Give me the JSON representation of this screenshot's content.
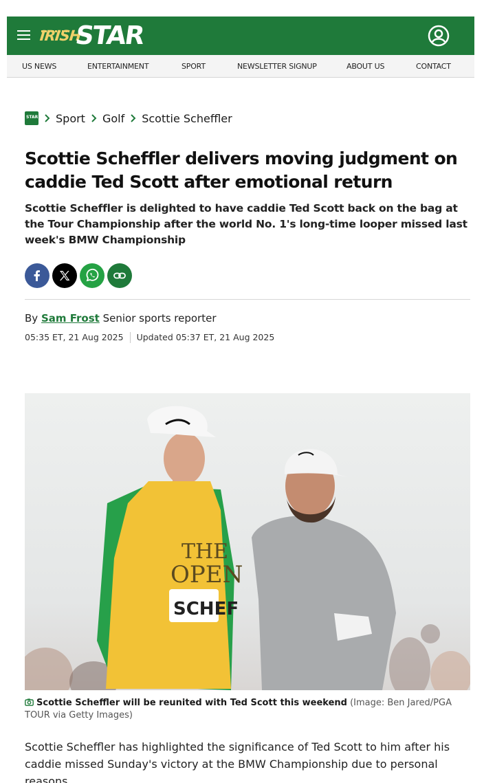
{
  "site": {
    "logo_text_irish": "IRISH",
    "logo_text_star": "STAR",
    "brand_color": "#1f7a3a"
  },
  "nav": {
    "items": [
      {
        "label": "US NEWS"
      },
      {
        "label": "ENTERTAINMENT"
      },
      {
        "label": "SPORT"
      },
      {
        "label": "NEWSLETTER SIGNUP"
      },
      {
        "label": "ABOUT US"
      },
      {
        "label": "CONTACT"
      }
    ]
  },
  "breadcrumb": {
    "logo_text": "STAR",
    "items": [
      {
        "label": "Sport"
      },
      {
        "label": "Golf"
      },
      {
        "label": "Scottie Scheffler"
      }
    ]
  },
  "article": {
    "headline": "Scottie Scheffler delivers moving judgment on caddie Ted Scott after emotional return",
    "standfirst": "Scottie Scheffler is delighted to have caddie Ted Scott back on the bag at the Tour Championship after the world No. 1's long-time looper missed last week's BMW Championship",
    "byline_prefix": "By",
    "author": "Sam Frost",
    "author_role": "Senior sports reporter",
    "published": "05:35 ET, 21 Aug 2025",
    "updated": "Updated 05:37 ET, 21 Aug 2025",
    "image_vest_text_1": "THE",
    "image_vest_text_2": "OPEN",
    "image_vest_name": "SCHEF",
    "caption_main": "Scottie Scheffler will be reunited with Ted Scott this weekend",
    "caption_credit": "(Image: Ben Jared/PGA TOUR via Getty Images)",
    "first_paragraph": "Scottie Scheffler has highlighted the significance of Ted Scott to him after his caddie missed Sunday's victory at the BMW Championship due to personal reasons."
  },
  "share": {
    "facebook_color": "#3b5998",
    "x_color": "#000000",
    "whatsapp_color": "#25a244",
    "link_color": "#1f7a3a"
  }
}
